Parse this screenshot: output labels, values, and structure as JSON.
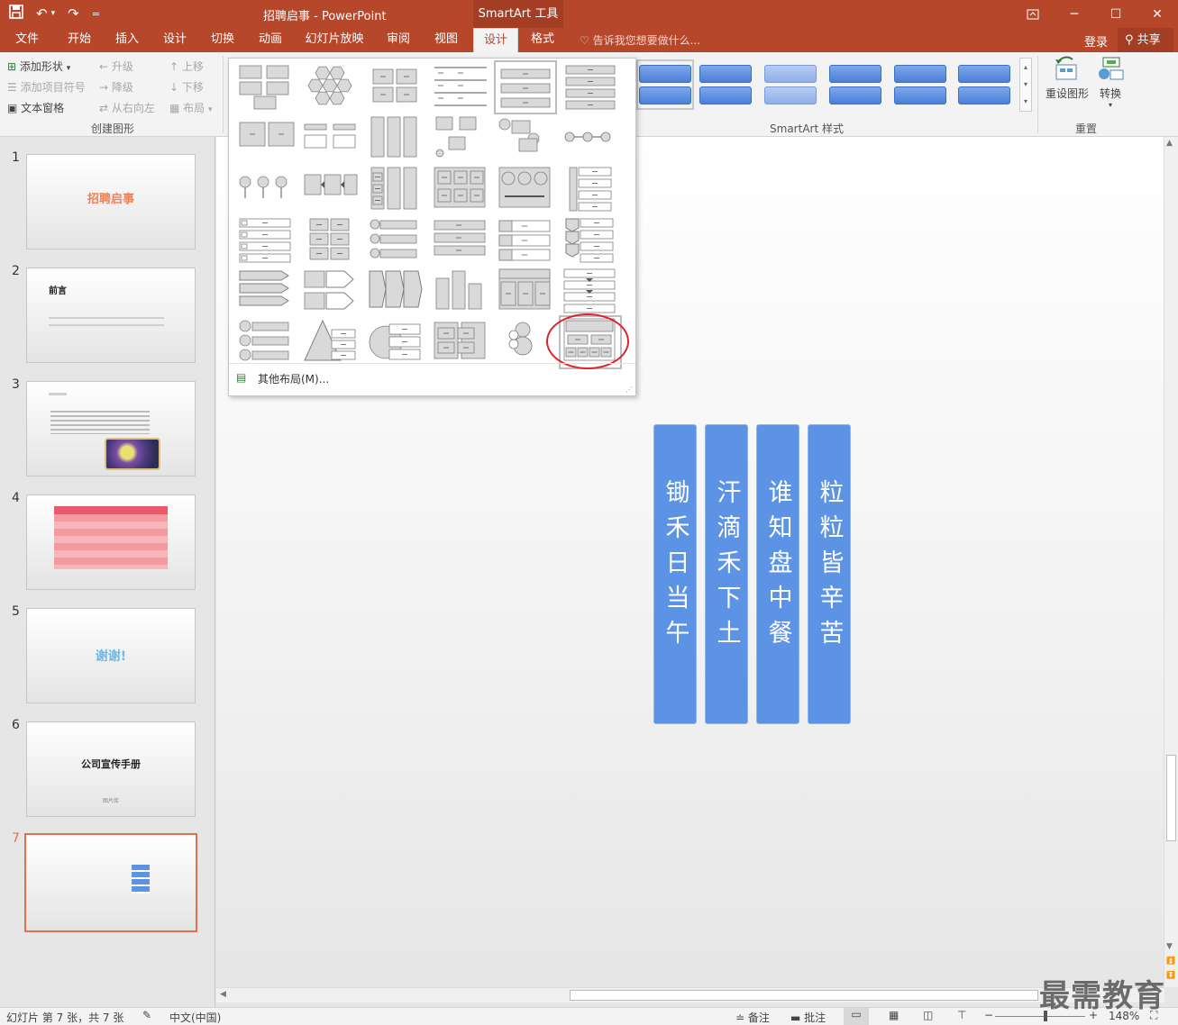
{
  "titlebar": {
    "doc_title": "招聘启事 - PowerPoint",
    "context_tab": "SmartArt 工具",
    "qat_customize": "="
  },
  "tabs": [
    "文件",
    "开始",
    "插入",
    "设计",
    "切换",
    "动画",
    "幻灯片放映",
    "审阅",
    "视图",
    "设计",
    "格式"
  ],
  "tellme": "告诉我您想要做什么...",
  "login": "登录",
  "share": "共享",
  "ribbon": {
    "create_graphic": {
      "add_shape": "添加形状",
      "add_bullet": "添加项目符号",
      "text_pane": "文本窗格",
      "promote": "升级",
      "demote": "降级",
      "rtl": "从右向左",
      "move_up": "上移",
      "move_down": "下移",
      "layout": "布局",
      "group_label": "创建图形"
    },
    "smartart_styles_label": "SmartArt 样式",
    "reset": {
      "reset_graphic": "重设图形",
      "convert": "转换",
      "group_label": "重置"
    }
  },
  "gallery": {
    "more_layouts": "其他布局(M)..."
  },
  "slides": [
    {
      "num": "1",
      "title": "招聘启事"
    },
    {
      "num": "2",
      "title": "前言"
    },
    {
      "num": "3",
      "title": ""
    },
    {
      "num": "4",
      "title": ""
    },
    {
      "num": "5",
      "title": "谢谢!"
    },
    {
      "num": "6",
      "title": "公司宣传手册",
      "subtitle": "图片库"
    },
    {
      "num": "7",
      "title": ""
    }
  ],
  "smartart": {
    "columns": [
      "锄禾日当午",
      "汗滴禾下土",
      "谁知盘中餐",
      "粒粒皆辛苦"
    ]
  },
  "status": {
    "slide_info": "幻灯片 第 7 张，共 7 张",
    "language": "中文(中国)",
    "notes": "备注",
    "comments": "批注",
    "zoom": "148%"
  },
  "watermark": "最需教育",
  "colors": {
    "accent": "#b7472a",
    "smartart_fill": "#5d93e4",
    "selection": "#e0704e",
    "circle": "#d9262c"
  }
}
